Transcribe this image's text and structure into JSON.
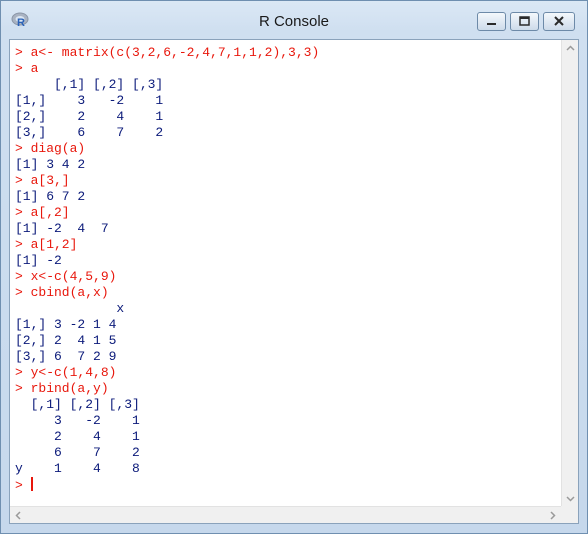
{
  "window": {
    "title": "R Console",
    "app_icon": "r-logo-icon",
    "controls": [
      "minimize-icon",
      "maximize-icon",
      "close-icon"
    ]
  },
  "colors": {
    "command": "#e8170c",
    "output": "#0b1a7a"
  },
  "console": {
    "lines": [
      {
        "type": "cmd",
        "text": "> a<- matrix(c(3,2,6,-2,4,7,1,1,2),3,3)"
      },
      {
        "type": "cmd",
        "text": "> a"
      },
      {
        "type": "out",
        "text": "     [,1] [,2] [,3]"
      },
      {
        "type": "out",
        "text": "[1,]    3   -2    1"
      },
      {
        "type": "out",
        "text": "[2,]    2    4    1"
      },
      {
        "type": "out",
        "text": "[3,]    6    7    2"
      },
      {
        "type": "cmd",
        "text": "> diag(a)"
      },
      {
        "type": "out",
        "text": "[1] 3 4 2"
      },
      {
        "type": "cmd",
        "text": "> a[3,]"
      },
      {
        "type": "out",
        "text": "[1] 6 7 2"
      },
      {
        "type": "cmd",
        "text": "> a[,2]"
      },
      {
        "type": "out",
        "text": "[1] -2  4  7"
      },
      {
        "type": "cmd",
        "text": "> a[1,2]"
      },
      {
        "type": "out",
        "text": "[1] -2"
      },
      {
        "type": "cmd",
        "text": "> x<-c(4,5,9)"
      },
      {
        "type": "cmd",
        "text": "> cbind(a,x)"
      },
      {
        "type": "out",
        "text": "             x"
      },
      {
        "type": "out",
        "text": "[1,] 3 -2 1 4"
      },
      {
        "type": "out",
        "text": "[2,] 2  4 1 5"
      },
      {
        "type": "out",
        "text": "[3,] 6  7 2 9"
      },
      {
        "type": "cmd",
        "text": "> y<-c(1,4,8)"
      },
      {
        "type": "cmd",
        "text": "> rbind(a,y)"
      },
      {
        "type": "out",
        "text": "  [,1] [,2] [,3]"
      },
      {
        "type": "out",
        "text": "     3   -2    1"
      },
      {
        "type": "out",
        "text": "     2    4    1"
      },
      {
        "type": "out",
        "text": "     6    7    2"
      },
      {
        "type": "out",
        "text": "y    1    4    8"
      }
    ],
    "prompt": "> "
  }
}
